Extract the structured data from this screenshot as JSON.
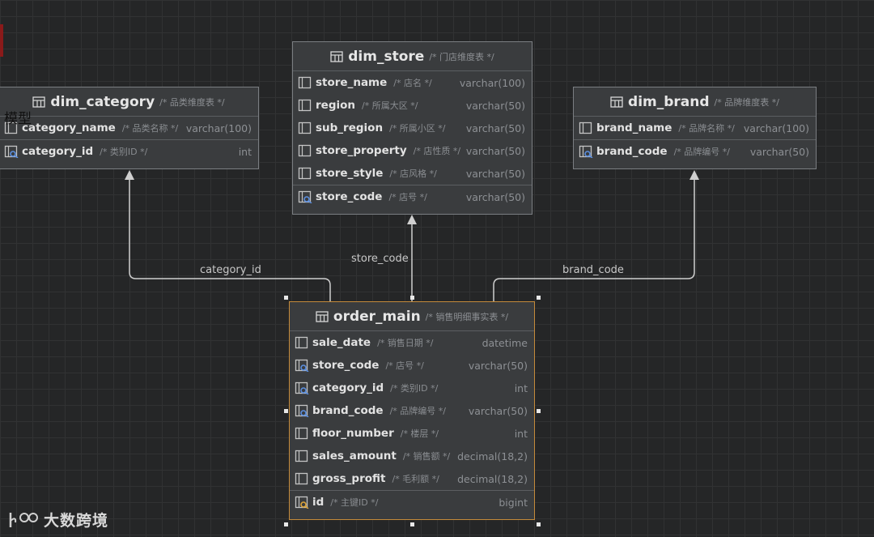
{
  "corner_text": "模型",
  "logo_text": "大数跨境",
  "links": [
    {
      "label": "category_id"
    },
    {
      "label": "store_code"
    },
    {
      "label": "brand_code"
    }
  ],
  "tables": {
    "dim_category": {
      "title": "dim_category",
      "comment": "/* 品类维度表 */",
      "columns": [
        {
          "name": "category_name",
          "comment": "/* 品类名称 */",
          "type": "varchar(100)",
          "icon": "column-icon"
        },
        {
          "name": "category_id",
          "comment": "/* 类别ID */",
          "type": "int",
          "icon": "key-column-icon"
        }
      ]
    },
    "dim_store": {
      "title": "dim_store",
      "comment": "/* 门店维度表 */",
      "columns": [
        {
          "name": "store_name",
          "comment": "/* 店名 */",
          "type": "varchar(100)",
          "icon": "column-icon"
        },
        {
          "name": "region",
          "comment": "/* 所属大区 */",
          "type": "varchar(50)",
          "icon": "column-icon"
        },
        {
          "name": "sub_region",
          "comment": "/* 所属小区 */",
          "type": "varchar(50)",
          "icon": "column-icon"
        },
        {
          "name": "store_property",
          "comment": "/* 店性质 */",
          "type": "varchar(50)",
          "icon": "column-icon"
        },
        {
          "name": "store_style",
          "comment": "/* 店风格 */",
          "type": "varchar(50)",
          "icon": "column-icon"
        },
        {
          "name": "store_code",
          "comment": "/* 店号 */",
          "type": "varchar(50)",
          "icon": "key-column-icon"
        }
      ]
    },
    "dim_brand": {
      "title": "dim_brand",
      "comment": "/* 品牌维度表 */",
      "columns": [
        {
          "name": "brand_name",
          "comment": "/* 品牌名称 */",
          "type": "varchar(100)",
          "icon": "column-icon"
        },
        {
          "name": "brand_code",
          "comment": "/* 品牌编号 */",
          "type": "varchar(50)",
          "icon": "key-column-icon"
        }
      ]
    },
    "order_main": {
      "title": "order_main",
      "comment": "/* 销售明细事实表 */",
      "columns": [
        {
          "name": "sale_date",
          "comment": "/* 销售日期 */",
          "type": "datetime",
          "icon": "column-icon"
        },
        {
          "name": "store_code",
          "comment": "/* 店号 */",
          "type": "varchar(50)",
          "icon": "foreign-key-icon"
        },
        {
          "name": "category_id",
          "comment": "/* 类别ID */",
          "type": "int",
          "icon": "foreign-key-icon"
        },
        {
          "name": "brand_code",
          "comment": "/* 品牌编号 */",
          "type": "varchar(50)",
          "icon": "foreign-key-icon"
        },
        {
          "name": "floor_number",
          "comment": "/* 楼层 */",
          "type": "int",
          "icon": "column-icon"
        },
        {
          "name": "sales_amount",
          "comment": "/* 销售额 */",
          "type": "decimal(18,2)",
          "icon": "column-icon"
        },
        {
          "name": "gross_profit",
          "comment": "/* 毛利额 */",
          "type": "decimal(18,2)",
          "icon": "column-icon"
        },
        {
          "name": "id",
          "comment": "/* 主键ID */",
          "type": "bigint",
          "icon": "primary-key-icon"
        }
      ]
    }
  }
}
